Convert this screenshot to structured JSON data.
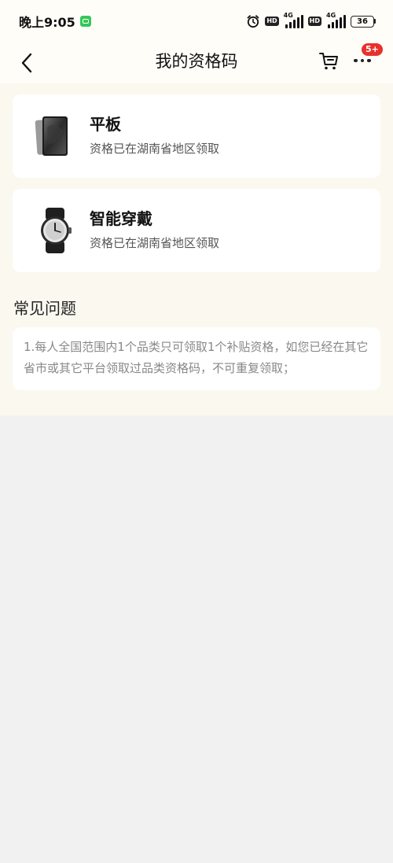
{
  "status_bar": {
    "time": "晚上9:05",
    "hd1": "HD",
    "net1": "4G",
    "hd2": "HD",
    "net2": "4G",
    "battery": "36"
  },
  "nav": {
    "title": "我的资格码",
    "badge": "5+"
  },
  "cards": [
    {
      "title": "平板",
      "subtitle": "资格已在湖南省地区领取",
      "icon": "tablet-image"
    },
    {
      "title": "智能穿戴",
      "subtitle": "资格已在湖南省地区领取",
      "icon": "smartwatch-image"
    }
  ],
  "faq": {
    "heading": "常见问题",
    "text": "1.每人全国范围内1个品类只可领取1个补贴资格，如您已经在其它省市或其它平台领取过品类资格码，不可重复领取；"
  },
  "colors": {
    "badge_red": "#e8312c",
    "header_bg": "#fffdf8",
    "content_bg": "#fbf8f0",
    "page_bg": "#f1f1f1"
  }
}
